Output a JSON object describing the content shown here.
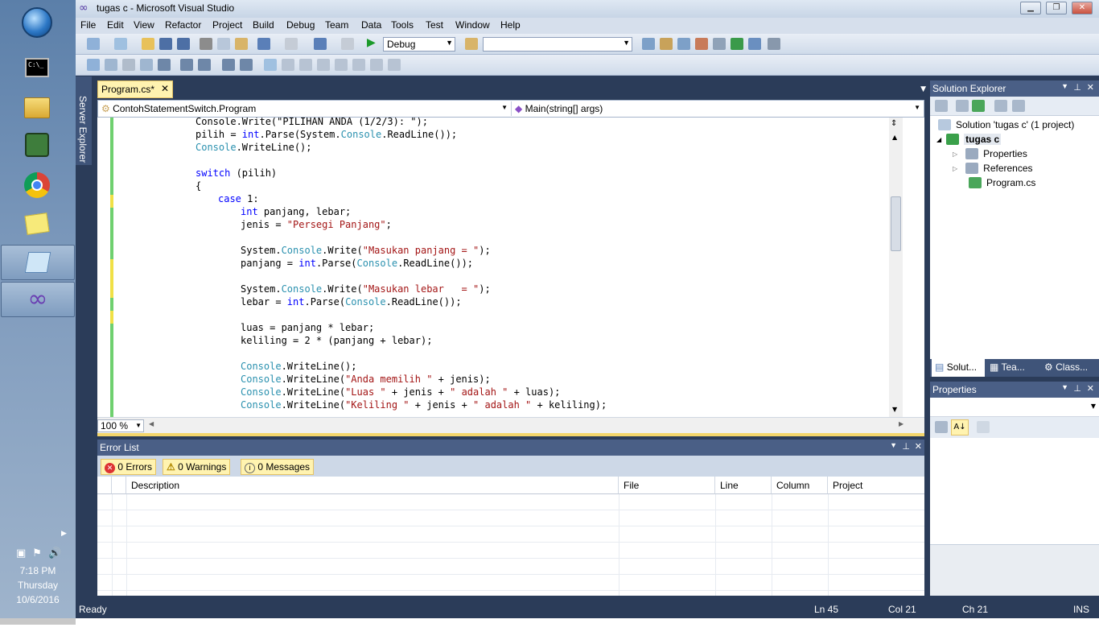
{
  "taskbar": {
    "apps": [
      {
        "name": "start-orb-icon"
      },
      {
        "name": "command-prompt-icon"
      },
      {
        "name": "file-explorer-icon"
      },
      {
        "name": "dbms-tool-icon"
      },
      {
        "name": "chrome-icon"
      },
      {
        "name": "sticky-notes-icon"
      },
      {
        "name": "notepad-icon"
      },
      {
        "name": "visual-studio-icon"
      }
    ],
    "clock": {
      "time": "7:18 PM",
      "day": "Thursday",
      "date": "10/6/2016"
    }
  },
  "window": {
    "title": "tugas c - Microsoft Visual Studio"
  },
  "menu": [
    "File",
    "Edit",
    "View",
    "Refactor",
    "Project",
    "Build",
    "Debug",
    "Team",
    "Data",
    "Tools",
    "Test",
    "Window",
    "Help"
  ],
  "toolbar": {
    "config": "Debug",
    "platform": ""
  },
  "server_explorer": {
    "label": "Server Explorer"
  },
  "editor": {
    "tab": "Program.cs*",
    "class_combo": "ContohStatementSwitch.Program",
    "member_combo": "Main(string[] args)",
    "zoom": "100 %",
    "lines": [
      {
        "indent": 8,
        "tokens": [
          {
            "t": "Console.Write(\"PILIHAN ANDA (1/2/3): \");",
            "c": ""
          }
        ]
      },
      {
        "indent": 8,
        "tokens": [
          {
            "t": "pilih = ",
            "c": ""
          },
          {
            "t": "int",
            "c": "kw"
          },
          {
            "t": ".Parse(System.",
            "c": ""
          },
          {
            "t": "Console",
            "c": "ty"
          },
          {
            "t": ".ReadLine());",
            "c": ""
          }
        ]
      },
      {
        "indent": 8,
        "tokens": [
          {
            "t": "Console",
            "c": "ty"
          },
          {
            "t": ".WriteLine();",
            "c": ""
          }
        ]
      },
      {
        "indent": 0,
        "tokens": []
      },
      {
        "indent": 8,
        "tokens": [
          {
            "t": "switch",
            "c": "kw"
          },
          {
            "t": " (pilih)",
            "c": ""
          }
        ]
      },
      {
        "indent": 8,
        "tokens": [
          {
            "t": "{",
            "c": ""
          }
        ]
      },
      {
        "indent": 12,
        "tokens": [
          {
            "t": "case",
            "c": "kw"
          },
          {
            "t": " 1:",
            "c": ""
          }
        ]
      },
      {
        "indent": 16,
        "tokens": [
          {
            "t": "int",
            "c": "kw"
          },
          {
            "t": " panjang, lebar;",
            "c": ""
          }
        ]
      },
      {
        "indent": 16,
        "tokens": [
          {
            "t": "jenis = ",
            "c": ""
          },
          {
            "t": "\"Persegi Panjang\"",
            "c": "st"
          },
          {
            "t": ";",
            "c": ""
          }
        ]
      },
      {
        "indent": 0,
        "tokens": []
      },
      {
        "indent": 16,
        "tokens": [
          {
            "t": "System.",
            "c": ""
          },
          {
            "t": "Console",
            "c": "ty"
          },
          {
            "t": ".Write(",
            "c": ""
          },
          {
            "t": "\"Masukan panjang = \"",
            "c": "st"
          },
          {
            "t": ");",
            "c": ""
          }
        ]
      },
      {
        "indent": 16,
        "tokens": [
          {
            "t": "panjang = ",
            "c": ""
          },
          {
            "t": "int",
            "c": "kw"
          },
          {
            "t": ".Parse(",
            "c": ""
          },
          {
            "t": "Console",
            "c": "ty"
          },
          {
            "t": ".ReadLine());",
            "c": ""
          }
        ]
      },
      {
        "indent": 0,
        "tokens": []
      },
      {
        "indent": 16,
        "tokens": [
          {
            "t": "System.",
            "c": ""
          },
          {
            "t": "Console",
            "c": "ty"
          },
          {
            "t": ".Write(",
            "c": ""
          },
          {
            "t": "\"Masukan lebar   = \"",
            "c": "st"
          },
          {
            "t": ");",
            "c": ""
          }
        ]
      },
      {
        "indent": 16,
        "tokens": [
          {
            "t": "lebar = ",
            "c": ""
          },
          {
            "t": "int",
            "c": "kw"
          },
          {
            "t": ".Parse(",
            "c": ""
          },
          {
            "t": "Console",
            "c": "ty"
          },
          {
            "t": ".ReadLine());",
            "c": ""
          }
        ]
      },
      {
        "indent": 0,
        "tokens": []
      },
      {
        "indent": 16,
        "tokens": [
          {
            "t": "luas = panjang * lebar;",
            "c": ""
          }
        ]
      },
      {
        "indent": 16,
        "tokens": [
          {
            "t": "keliling = 2 * (panjang + lebar);",
            "c": ""
          }
        ]
      },
      {
        "indent": 0,
        "tokens": []
      },
      {
        "indent": 16,
        "tokens": [
          {
            "t": "Console",
            "c": "ty"
          },
          {
            "t": ".WriteLine();",
            "c": ""
          }
        ]
      },
      {
        "indent": 16,
        "tokens": [
          {
            "t": "Console",
            "c": "ty"
          },
          {
            "t": ".WriteLine(",
            "c": ""
          },
          {
            "t": "\"Anda memilih \"",
            "c": "st"
          },
          {
            "t": " + jenis);",
            "c": ""
          }
        ]
      },
      {
        "indent": 16,
        "tokens": [
          {
            "t": "Console",
            "c": "ty"
          },
          {
            "t": ".WriteLine(",
            "c": ""
          },
          {
            "t": "\"Luas \"",
            "c": "st"
          },
          {
            "t": " + jenis + ",
            "c": ""
          },
          {
            "t": "\" adalah \"",
            "c": "st"
          },
          {
            "t": " + luas);",
            "c": ""
          }
        ]
      },
      {
        "indent": 16,
        "tokens": [
          {
            "t": "Console",
            "c": "ty"
          },
          {
            "t": ".WriteLine(",
            "c": ""
          },
          {
            "t": "\"Keliling \"",
            "c": "st"
          },
          {
            "t": " + jenis + ",
            "c": ""
          },
          {
            "t": "\" adalah \"",
            "c": "st"
          },
          {
            "t": " + keliling);",
            "c": ""
          }
        ]
      }
    ]
  },
  "error_list": {
    "title": "Error List",
    "errors": "0 Errors",
    "warnings": "0 Warnings",
    "messages": "0 Messages",
    "columns": [
      "Description",
      "File",
      "Line",
      "Column",
      "Project"
    ]
  },
  "solution_explorer": {
    "title": "Solution Explorer",
    "solution": "Solution 'tugas c' (1 project)",
    "project": "tugas c",
    "items": [
      "Properties",
      "References",
      "Program.cs"
    ],
    "tabs": [
      "Solut...",
      "Tea...",
      "Class..."
    ]
  },
  "properties": {
    "title": "Properties"
  },
  "status": {
    "ready": "Ready",
    "ln": "Ln 45",
    "col": "Col 21",
    "ch": "Ch 21",
    "ins": "INS"
  },
  "colors": {
    "keyword": "#0000ff",
    "type": "#2b91af",
    "string": "#a31515",
    "chrome": "#2b3c59"
  }
}
